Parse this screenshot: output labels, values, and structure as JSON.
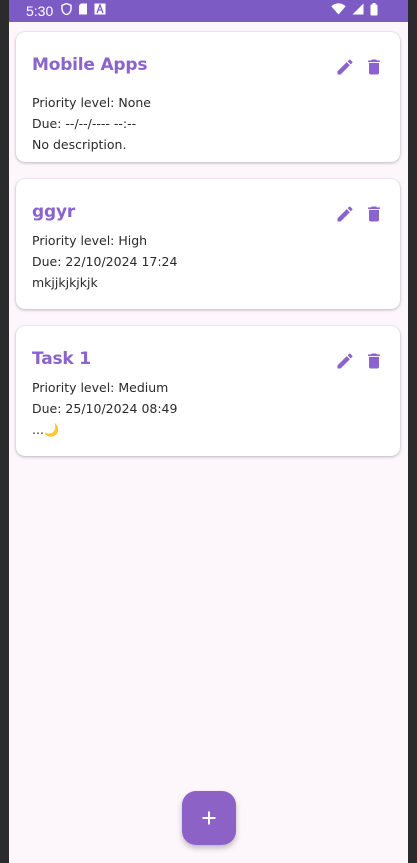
{
  "status_bar": {
    "time": "5:30",
    "icons_left": [
      "shield-icon",
      "sd-card-icon",
      "text-a-icon"
    ],
    "icons_right": [
      "wifi-icon",
      "signal-icon",
      "battery-icon"
    ],
    "color": "#7c5cc4"
  },
  "tasks": [
    {
      "title": "Mobile Apps",
      "priority": "Priority level: None",
      "due": "Due: --/--/---- --:--",
      "description": "No description."
    },
    {
      "title": "ggyr",
      "priority": "Priority level: High",
      "due": "Due: 22/10/2024 17:24",
      "description": "mkjjkjkjkjk"
    },
    {
      "title": "Task 1",
      "priority": "Priority level: Medium",
      "due": "Due: 25/10/2024 08:49",
      "description": "...🌙"
    }
  ],
  "fab": {
    "icon": "plus-icon",
    "label": "+"
  },
  "colors": {
    "accent": "#8a63cc",
    "background": "#fdf7fc",
    "card": "#ffffff"
  }
}
